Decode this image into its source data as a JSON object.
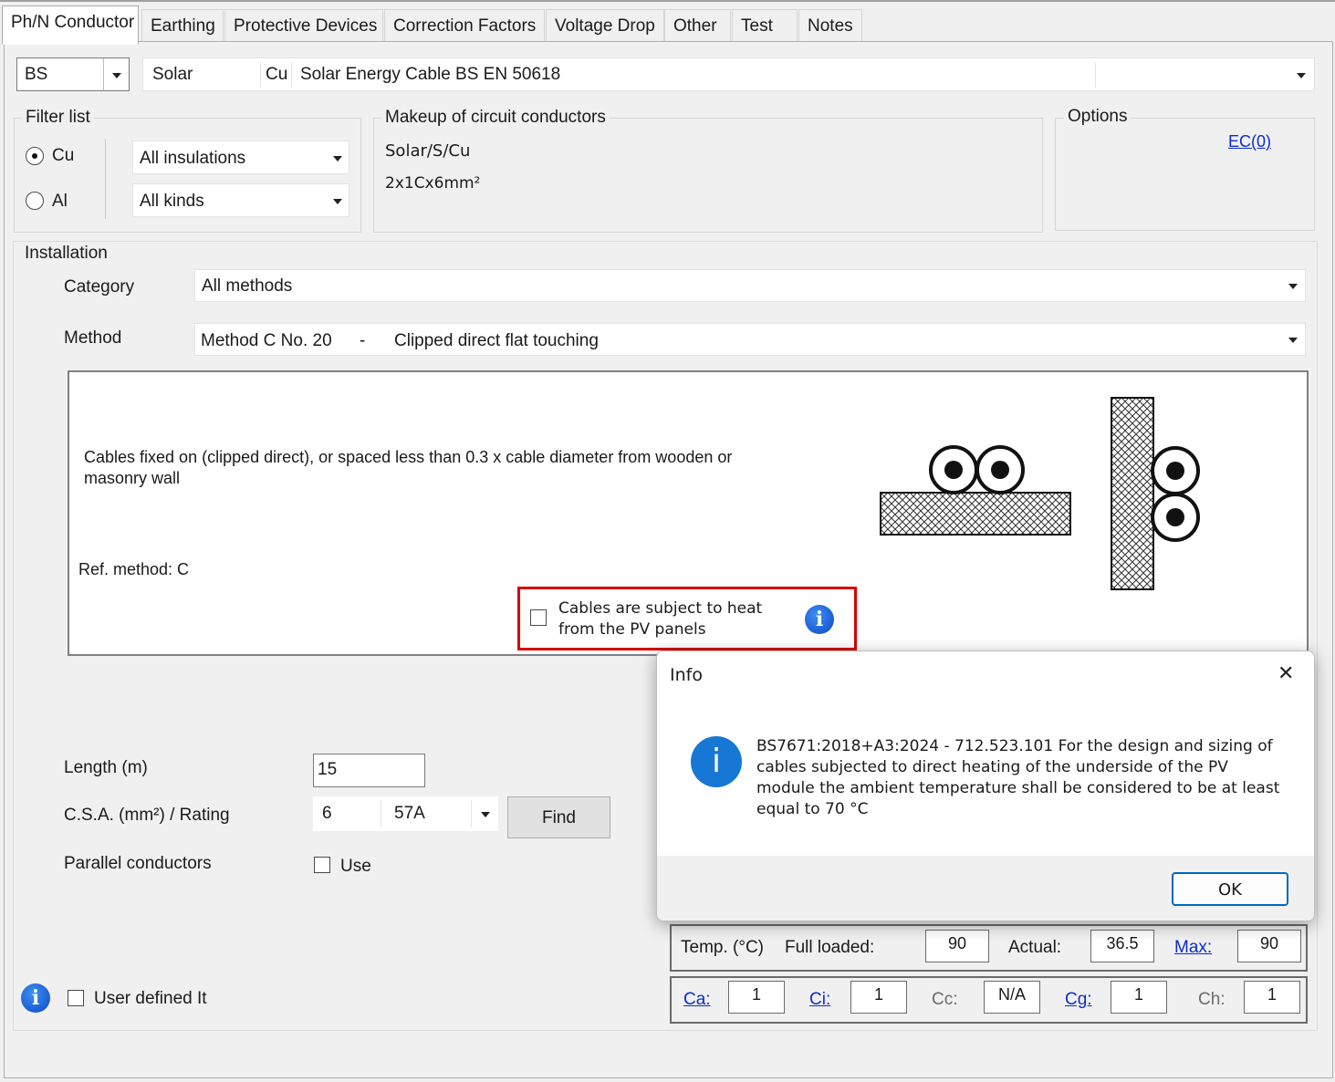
{
  "tabs": [
    "Ph/N Conductor",
    "Earthing",
    "Protective Devices",
    "Correction Factors",
    "Voltage Drop",
    "Other",
    "Test",
    "Notes"
  ],
  "cable_selector": {
    "standard": "BS",
    "type": "Solar",
    "material": "Cu",
    "description": "Solar Energy Cable BS EN 50618"
  },
  "filter_list": {
    "title": "Filter list",
    "radio_cu": "Cu",
    "radio_al": "Al",
    "selected": "Cu",
    "insulations": "All insulations",
    "kinds": "All kinds"
  },
  "makeup": {
    "title": "Makeup of circuit conductors",
    "line1": "Solar/S/Cu",
    "line2": "2x1Cx6mm²"
  },
  "options": {
    "title": "Options",
    "ec_link": "EC(0)"
  },
  "installation": {
    "title": "Installation",
    "category_label": "Category",
    "category_value": "All methods",
    "method_label": "Method",
    "method_code": "Method C No. 20",
    "method_dash": "-",
    "method_desc": "Clipped direct flat touching",
    "description": "Cables fixed on (clipped direct), or spaced less than 0.3 x cable diameter from wooden or masonry wall",
    "ref_method": "Ref. method: C",
    "pv_checkbox_label": "Cables are subject to heat from the PV panels",
    "pv_checked": false
  },
  "sizing": {
    "length_label": "Length (m)",
    "length_value": "15",
    "csa_label": "C.S.A. (mm²) / Rating",
    "csa_value": "6",
    "rating_value": "57A",
    "find_button": "Find",
    "parallel_label": "Parallel conductors",
    "use_label": "Use",
    "user_defined_label": "User defined It"
  },
  "temperature": {
    "label": "Temp. (°C)",
    "full_loaded_label": "Full loaded:",
    "full_loaded_value": "90",
    "actual_label": "Actual:",
    "actual_value": "36.5",
    "max_label": "Max:",
    "max_value": "90"
  },
  "factors": {
    "ca_label": "Ca:",
    "ca_value": "1",
    "ci_label": "Ci:",
    "ci_value": "1",
    "cc_label": "Cc:",
    "cc_value": "N/A",
    "cg_label": "Cg:",
    "cg_value": "1",
    "ch_label": "Ch:",
    "ch_value": "1"
  },
  "dialog": {
    "title": "Info",
    "close_glyph": "✕",
    "message": "BS7671:2018+A3:2024 - 712.523.101 For the design and sizing of cables subjected to direct heating of the underside of the PV module the ambient temperature shall be considered to be at least equal to 70 °C",
    "ok_button": "OK"
  },
  "icons": {
    "info_glyph": "i"
  },
  "colors": {
    "highlight_border": "#d60000",
    "link": "#0b2dce",
    "info_blue": "#1a6fe0"
  }
}
